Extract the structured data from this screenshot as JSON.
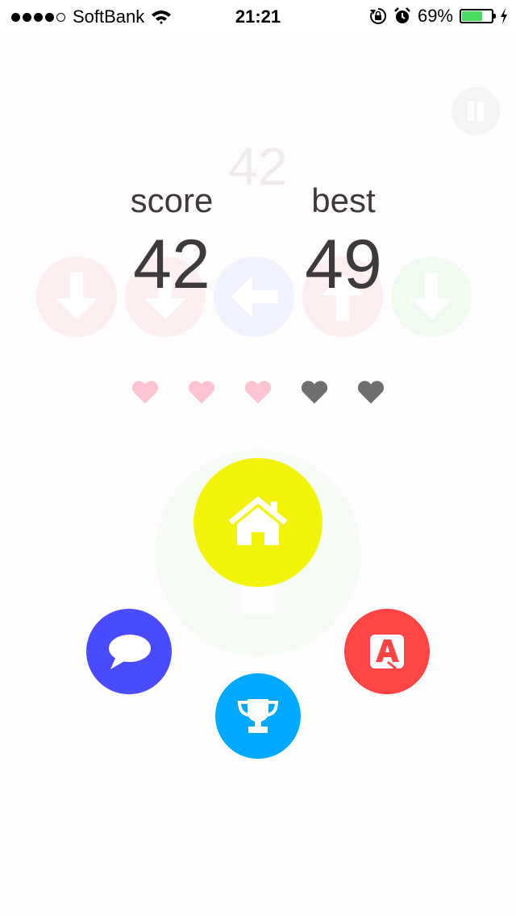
{
  "status_bar": {
    "signal_dots": [
      true,
      true,
      true,
      true,
      false
    ],
    "carrier": "SoftBank",
    "time": "21:21",
    "battery_percent": "69%",
    "battery_level": 0.69,
    "icons": [
      "wifi-icon",
      "rotation-lock-icon",
      "alarm-icon",
      "battery-icon",
      "charging-bolt-icon"
    ]
  },
  "game": {
    "ghost_score": "42",
    "score_label": "score",
    "score_value": "42",
    "best_label": "best",
    "best_value": "49",
    "arrows": [
      {
        "direction": "down",
        "color": "#fdeff0"
      },
      {
        "direction": "down",
        "color": "#fdeff0"
      },
      {
        "direction": "left",
        "color": "#f0f2fd"
      },
      {
        "direction": "up",
        "color": "#fdeff0"
      },
      {
        "direction": "down",
        "color": "#f0fbef"
      }
    ],
    "lives": {
      "total": 5,
      "remaining": 3,
      "active_color": "#ffc4d1",
      "lost_color": "#6e6e6e"
    }
  },
  "menu": {
    "home": {
      "icon": "home-icon",
      "color": "#f2f20a"
    },
    "chat": {
      "icon": "speech-bubble-icon",
      "color": "#4a4aff"
    },
    "ranking": {
      "icon": "trophy-icon",
      "color": "#00a8ff"
    },
    "appstore": {
      "icon": "app-store-icon",
      "color": "#ff4545"
    }
  },
  "colors": {
    "background": "#fefcfd",
    "text": "#3e3a3b",
    "pause_button": "#f6f3f4",
    "ring": "#f6fbf5"
  }
}
